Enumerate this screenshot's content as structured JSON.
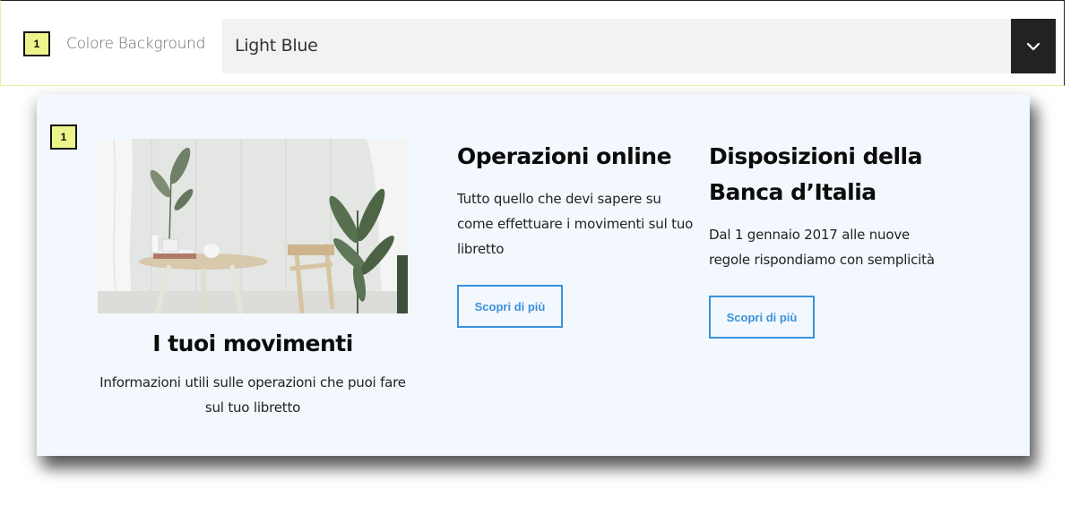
{
  "control": {
    "badge": "1",
    "label": "Colore Background",
    "selected_value": "Light Blue",
    "toggle_icon": "chevron-down-icon"
  },
  "preview": {
    "badge": "1",
    "background_color": "#f3f8fe",
    "card1": {
      "title": "I tuoi movimenti",
      "text": "Informazioni utili sulle operazioni che puoi fare sul tuo libretto"
    },
    "card2": {
      "title": "Operazioni online",
      "text": "Tutto quello che devi sapere su come effettuare i movimenti sul tuo libretto",
      "button": "Scopri di più"
    },
    "card3": {
      "title": "Disposizioni della Banca d’Italia",
      "text": "Dal 1 gennaio 2017 alle nuove regole rispondiamo con semplicità",
      "button": "Scopri di più"
    }
  },
  "colors": {
    "accent": "#3b91dc",
    "badge": "#ecf58c",
    "toggle": "#222222"
  }
}
